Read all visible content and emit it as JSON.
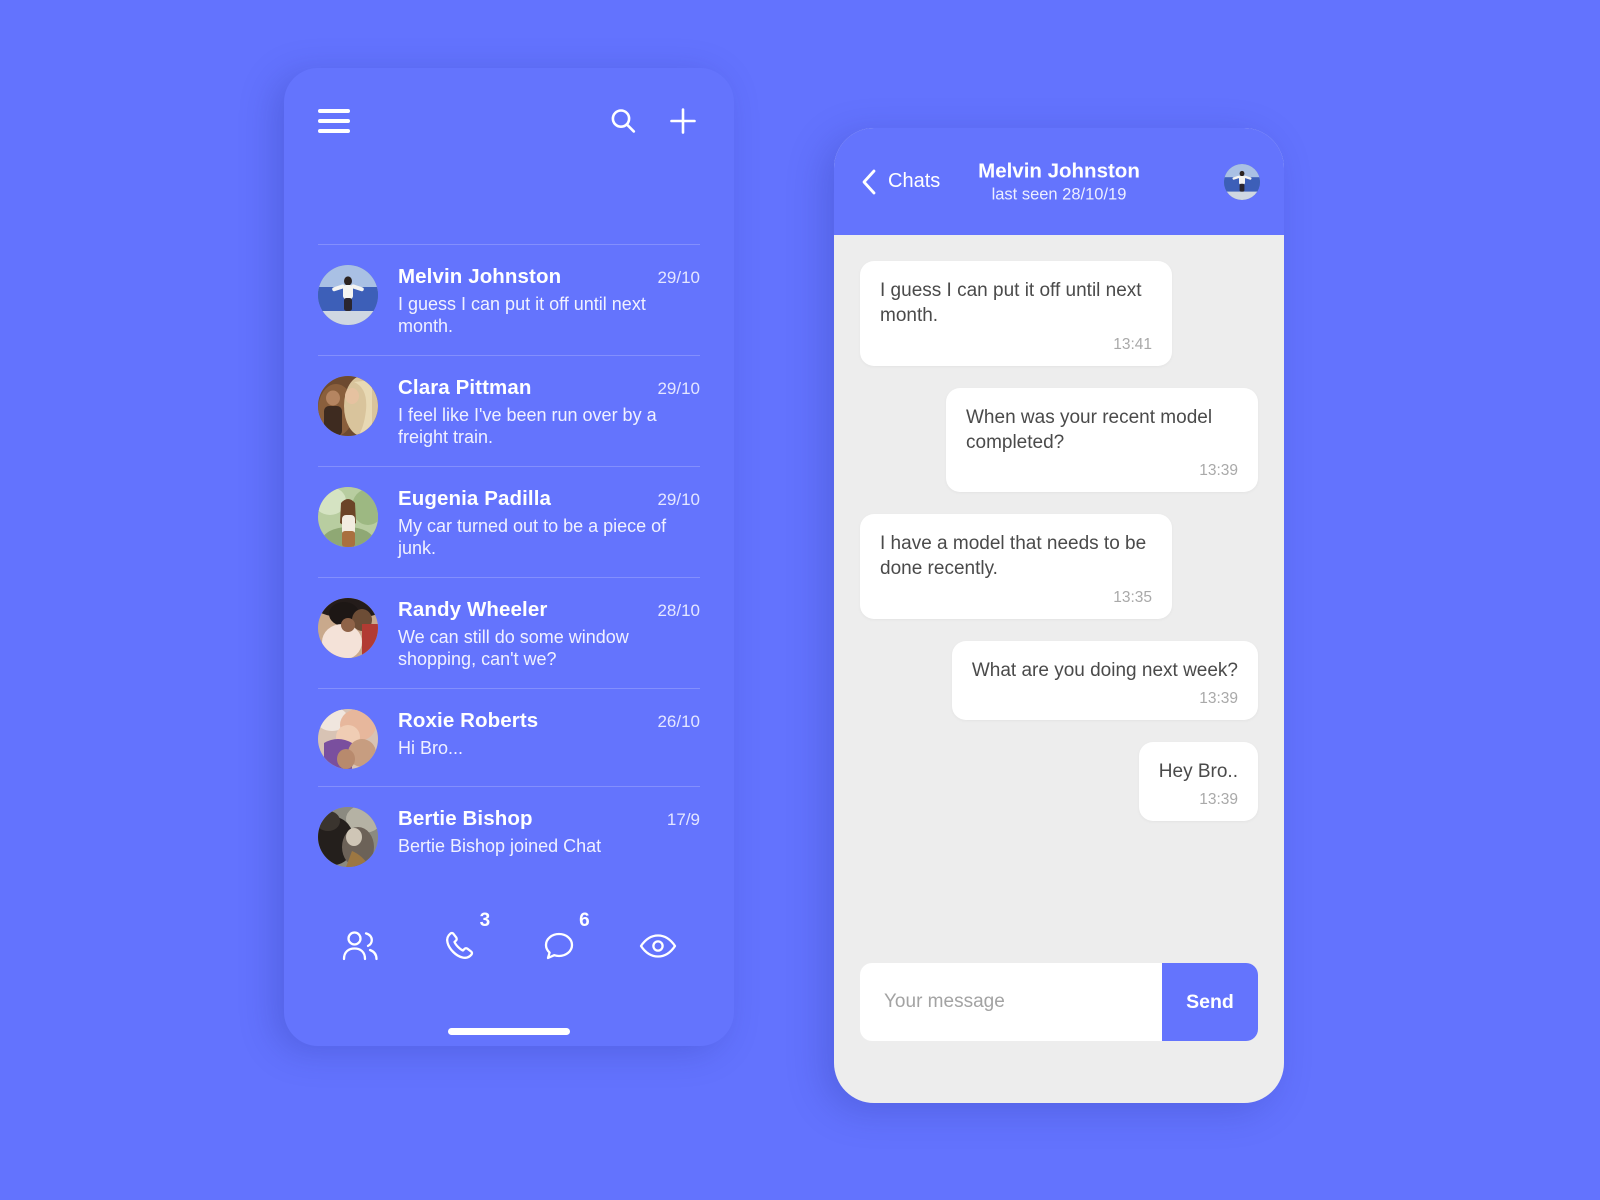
{
  "chat_list_screen": {
    "topbar": {
      "menu_icon": "hamburger-menu-icon",
      "search_icon": "search-icon",
      "add_icon": "plus-add-icon"
    },
    "conversations": [
      {
        "name": "Melvin Johnston",
        "date": "29/10",
        "preview": "I guess I can put it off until next month.",
        "avatar": "melvin-avatar"
      },
      {
        "name": "Clara Pittman",
        "date": "29/10",
        "preview": "I feel like I've been run over by a freight train.",
        "avatar": "clara-avatar"
      },
      {
        "name": "Eugenia Padilla",
        "date": "29/10",
        "preview": "My car turned out to be a piece of junk.",
        "avatar": "eugenia-avatar"
      },
      {
        "name": "Randy Wheeler",
        "date": "28/10",
        "preview": "We can still do some window shopping, can't we?",
        "avatar": "randy-avatar"
      },
      {
        "name": "Roxie Roberts",
        "date": "26/10",
        "preview": "Hi Bro...",
        "avatar": "roxie-avatar"
      },
      {
        "name": "Bertie Bishop",
        "date": "17/9",
        "preview": "Bertie Bishop joined Chat",
        "avatar": "bertie-avatar"
      }
    ],
    "bottom_nav": [
      {
        "icon": "contacts-people-icon",
        "badge": ""
      },
      {
        "icon": "phone-call-icon",
        "badge": "3"
      },
      {
        "icon": "chat-bubble-icon",
        "badge": "6"
      },
      {
        "icon": "eye-view-icon",
        "badge": ""
      }
    ]
  },
  "chat_detail_screen": {
    "header": {
      "back_label": "Chats",
      "back_icon": "chevron-left-icon",
      "title": "Melvin Johnston",
      "subtitle": "last seen 28/10/19",
      "avatar": "melvin-avatar"
    },
    "messages": [
      {
        "text": "I guess I can put it off until next month.",
        "time": "13:41",
        "side": "incoming"
      },
      {
        "text": "When was your recent model completed?",
        "time": "13:39",
        "side": "outgoing"
      },
      {
        "text": "I have a model that needs to be done recently.",
        "time": "13:35",
        "side": "incoming"
      },
      {
        "text": "What are you doing next week?",
        "time": "13:39",
        "side": "outgoing"
      },
      {
        "text": "Hey Bro..",
        "time": "13:39",
        "side": "outgoing"
      }
    ],
    "composer": {
      "placeholder": "Your message",
      "value": "",
      "send_label": "Send"
    }
  },
  "colors": {
    "page_background": "#6373fe",
    "phone_surface": "#6474fd",
    "chat_background": "#ededed",
    "bubble": "#ffffff",
    "accent": "#6474fd",
    "text_light": "#ffffff",
    "text_dark": "#4a4a4a",
    "time_text": "#a9a9a9"
  }
}
